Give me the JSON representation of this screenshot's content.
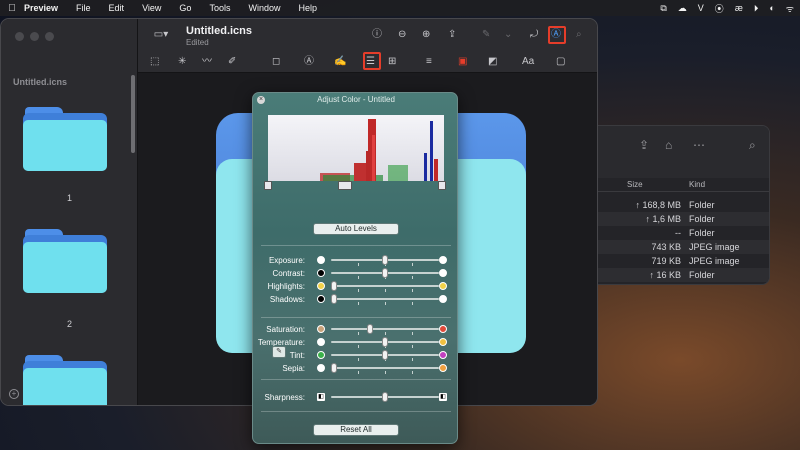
{
  "menubar": {
    "apple": "",
    "items": [
      "Preview",
      "File",
      "Edit",
      "View",
      "Go",
      "Tools",
      "Window",
      "Help"
    ],
    "status": [
      "⧉",
      "☁",
      "V",
      "⦿",
      "æ",
      "⏵",
      "◐",
      "ᯤ"
    ]
  },
  "preview": {
    "doc_title": "Untitled.icns",
    "doc_subtitle": "Edited",
    "sidebar_title": "Untitled.icns",
    "thumb_numbers": [
      "1",
      "2"
    ],
    "toolbar_icons": [
      "sidebar-toggle-icon",
      "info-icon",
      "zoom-out-icon",
      "zoom-in-icon",
      "share-icon",
      "highlight-icon",
      "rotate-icon",
      "markup-icon",
      "search-icon"
    ],
    "toolbar2_text_label": "Aa"
  },
  "adjust": {
    "title": "Adjust Color - Untitled",
    "auto_levels": "Auto Levels",
    "reset_all": "Reset All",
    "rows1": [
      {
        "label": "Exposure:",
        "level": 0.5
      },
      {
        "label": "Contrast:",
        "level": 0.5
      },
      {
        "label": "Highlights:",
        "level": 0.0
      },
      {
        "label": "Shadows:",
        "level": 0.0
      }
    ],
    "rows2": [
      {
        "label": "Saturation:",
        "level": 0.35
      },
      {
        "label": "Temperature:",
        "level": 0.5
      },
      {
        "label": "Tint:",
        "level": 0.5
      },
      {
        "label": "Sepia:",
        "level": 0.0
      }
    ],
    "sharpness_label": "Sharpness:",
    "sharpness_level": 0.5
  },
  "finder": {
    "col_size": "Size",
    "col_kind": "Kind",
    "rows": [
      {
        "size": "↑ 168,8 MB",
        "kind": "Folder"
      },
      {
        "size": "↑ 1,6 MB",
        "kind": "Folder"
      },
      {
        "size": "--",
        "kind": "Folder"
      },
      {
        "size": "743 KB",
        "kind": "JPEG image"
      },
      {
        "size": "719 KB",
        "kind": "JPEG image"
      },
      {
        "size": "↑ 16 KB",
        "kind": "Folder"
      }
    ]
  },
  "colors": {
    "highlight_box": "#e53d2a",
    "folder_front": "#8fe6ee",
    "folder_back": "#4d87e0",
    "panel_bg": "#467472"
  }
}
